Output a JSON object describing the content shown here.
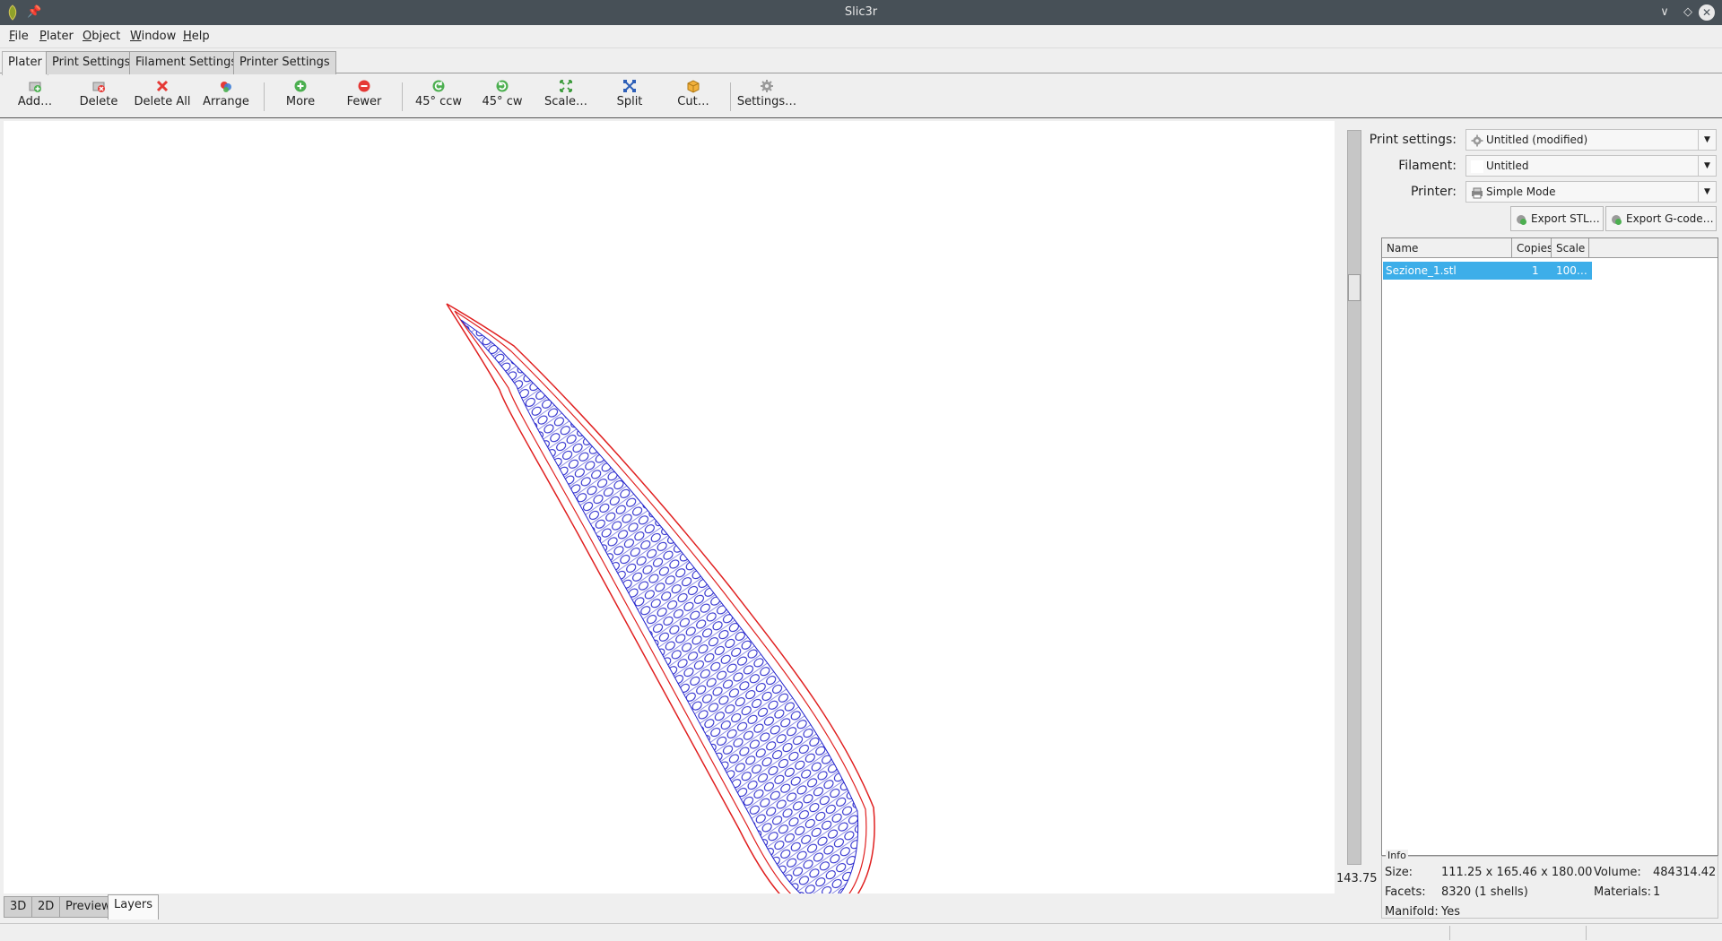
{
  "window": {
    "title": "Slic3r"
  },
  "menu": [
    {
      "key": "F",
      "rest": "ile"
    },
    {
      "key": "P",
      "rest": "later"
    },
    {
      "key": "O",
      "rest": "bject"
    },
    {
      "key": "W",
      "rest": "indow"
    },
    {
      "key": "H",
      "rest": "elp"
    }
  ],
  "tabs": [
    "Plater",
    "Print Settings",
    "Filament Settings",
    "Printer Settings"
  ],
  "toolbar": {
    "add": "Add…",
    "delete": "Delete",
    "delete_all": "Delete All",
    "arrange": "Arrange",
    "more": "More",
    "fewer": "Fewer",
    "rotate_ccw": "45° ccw",
    "rotate_cw": "45° cw",
    "scale": "Scale…",
    "split": "Split",
    "cut": "Cut…",
    "settings": "Settings…"
  },
  "layer_slider": {
    "z_value": "143.75"
  },
  "view_tabs": [
    "3D",
    "2D",
    "Preview",
    "Layers"
  ],
  "panel": {
    "print_settings_label": "Print settings:",
    "print_settings_value": "Untitled (modified)",
    "filament_label": "Filament:",
    "filament_value": "Untitled",
    "printer_label": "Printer:",
    "printer_value": "Simple Mode",
    "export_stl": "Export STL…",
    "export_gcode": "Export G-code…"
  },
  "object_list": {
    "columns": [
      "Name",
      "Copies",
      "Scale"
    ],
    "rows": [
      {
        "name": "Sezione_1.stl",
        "copies": "1",
        "scale": "100…"
      }
    ]
  },
  "info": {
    "legend": "Info",
    "size_label": "Size:",
    "size_value": "111.25 x 165.46 x 180.00",
    "volume_label": "Volume:",
    "volume_value": "484314.42",
    "facets_label": "Facets:",
    "facets_value": "8320 (1 shells)",
    "materials_label": "Materials:",
    "materials_value": "1",
    "manifold_label": "Manifold:",
    "manifold_value": "Yes"
  },
  "colors": {
    "perimeter": "#e02020",
    "infill": "#2222cc",
    "selection": "#3daee9",
    "titlebar": "#475057"
  }
}
